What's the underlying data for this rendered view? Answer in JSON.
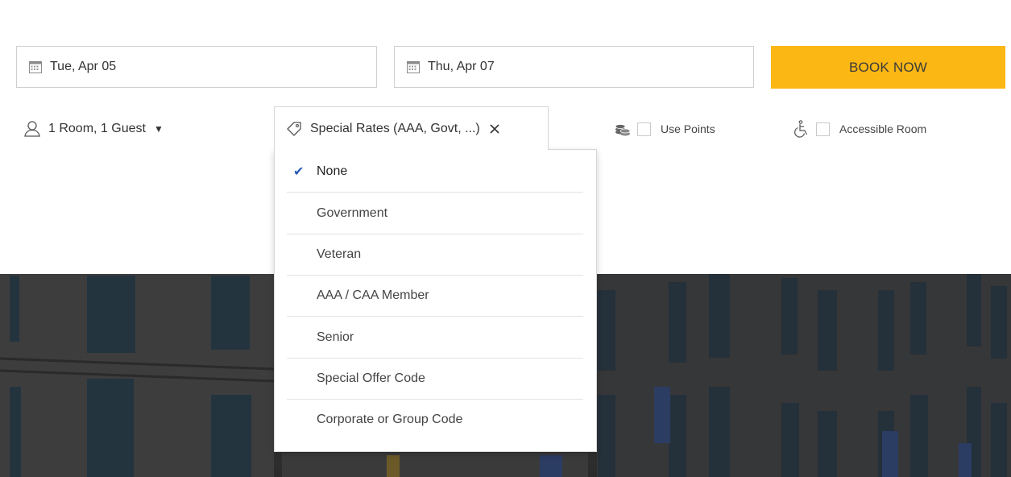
{
  "booking": {
    "checkin_date": "Tue, Apr 05",
    "checkout_date": "Thu, Apr 07",
    "book_label": "BOOK NOW"
  },
  "options": {
    "rooms_guests": "1 Room, 1 Guest",
    "special_rates": "Special Rates (AAA, Govt, ...)",
    "use_points_label": "Use Points",
    "accessible_label": "Accessible Room"
  },
  "rates_dropdown": {
    "items": [
      {
        "label": "None",
        "selected": true
      },
      {
        "label": "Government",
        "selected": false
      },
      {
        "label": "Veteran",
        "selected": false
      },
      {
        "label": "AAA / CAA Member",
        "selected": false
      },
      {
        "label": "Senior",
        "selected": false
      },
      {
        "label": "Special Offer Code",
        "selected": false
      },
      {
        "label": "Corporate or Group Code",
        "selected": false
      }
    ]
  },
  "icons": {
    "checkin": "calendar-icon",
    "checkout": "calendar-icon",
    "guests": "person-icon",
    "rates": "tag-icon",
    "clear": "close-icon",
    "points": "coins-icon",
    "accessible": "wheelchair-icon",
    "selected_mark": "checkmark-icon"
  },
  "colors": {
    "accent": "#fbb714",
    "check": "#2a5bb7"
  }
}
